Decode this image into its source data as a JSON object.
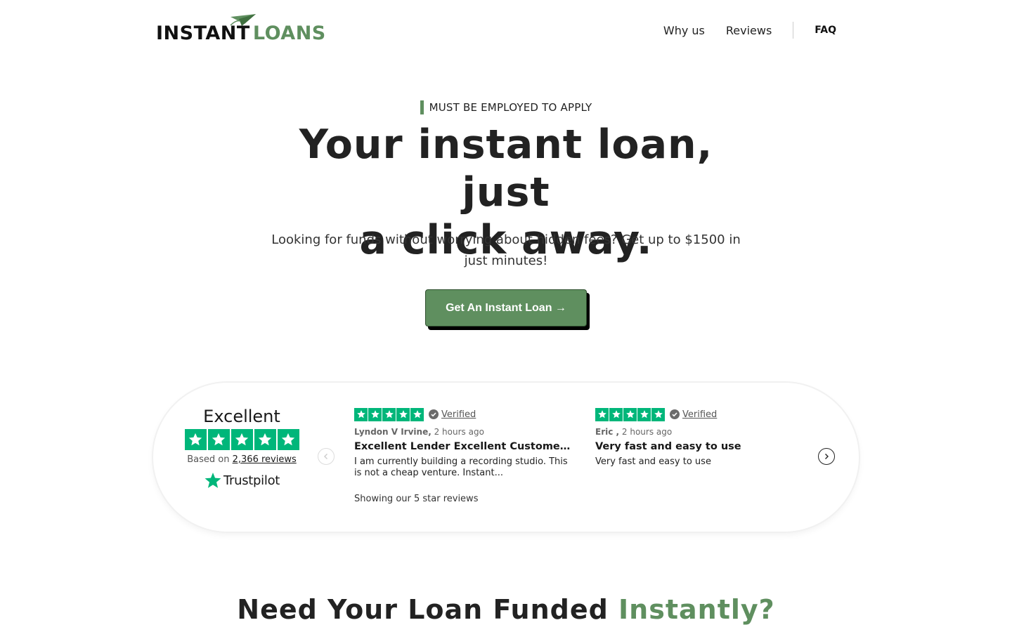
{
  "header": {
    "logo": {
      "word1": "INSTANT",
      "word2": "LOANS"
    },
    "nav": {
      "why_us": "Why us",
      "reviews": "Reviews",
      "faq": "FAQ"
    }
  },
  "hero": {
    "eyebrow": "MUST BE EMPLOYED TO APPLY",
    "title_line1": "Your instant loan, just",
    "title_line2": "a click away.",
    "subtitle": "Looking for funds without worrying about hidden fees? Get up to $1500 in just minutes!",
    "cta_label": "Get An Instant Loan →"
  },
  "trustpilot": {
    "rating_label": "Excellent",
    "stars": 5,
    "based_on_prefix": "Based on",
    "review_count": "2,366 reviews",
    "brand": "Trustpilot",
    "showing_label": "Showing our 5 star reviews",
    "reviews": [
      {
        "stars": 5,
        "verified_label": "Verified",
        "author": "Lyndon V Irvine,",
        "time": "2 hours ago",
        "title": "Excellent Lender Excellent Customer Service",
        "body": "I am currently building a recording studio. This is not a cheap venture. Instant..."
      },
      {
        "stars": 5,
        "verified_label": "Verified",
        "author": "Eric ,",
        "time": "2 hours ago",
        "title": "Very fast and easy to use",
        "body": "Very fast and easy to use"
      }
    ]
  },
  "section": {
    "title_part1": "Need Your Loan Funded",
    "title_accent": "Instantly?"
  },
  "colors": {
    "brand_green": "#5f8f5f",
    "trustpilot_green": "#00b67a",
    "text_dark": "#222222"
  },
  "icons": {
    "logo": "paper-plane-icon",
    "verified": "check-circle-icon",
    "prev": "chevron-left-icon",
    "next": "chevron-right-icon",
    "star": "star-icon"
  }
}
